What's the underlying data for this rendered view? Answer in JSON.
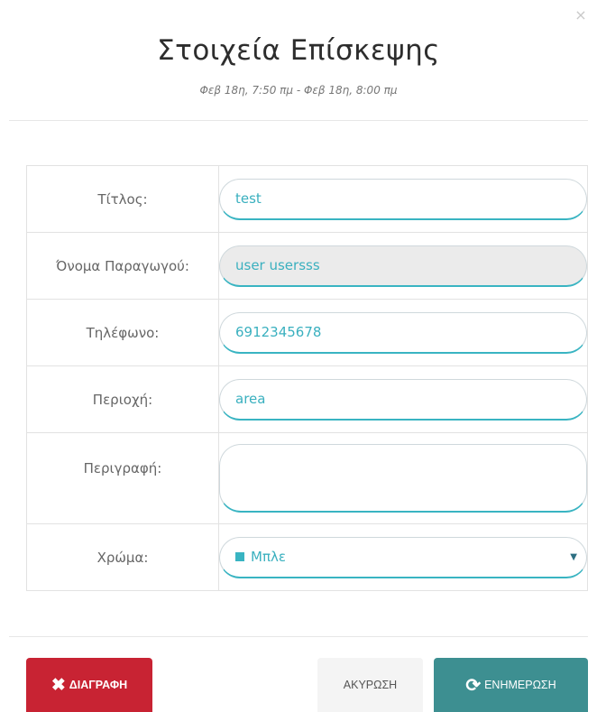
{
  "modal": {
    "close": "×",
    "title": "Στοιχεία Επίσκεψης",
    "subtitle": "Φεβ 18η, 7:50 πμ - Φεβ 18η, 8:00 πμ"
  },
  "form": {
    "title_label": "Τίτλος:",
    "title_value": "test",
    "producer_label": "Όνομα Παραγωγού:",
    "producer_value": "user usersss",
    "phone_label": "Τηλέφωνο:",
    "phone_value": "6912345678",
    "region_label": "Περιοχή:",
    "region_value": "area",
    "description_label": "Περιγραφή:",
    "description_value": "",
    "color_label": "Χρώμα:",
    "color_value": "Μπλε",
    "color_swatch": "#39b4c2"
  },
  "buttons": {
    "delete_icon": "✖",
    "delete_label": "ΔΙΑΓΡΑΦΗ",
    "cancel_label": "ΑΚΥΡΩΣΗ",
    "update_icon": "⟳",
    "update_label": "ΕΝΗΜΕΡΩΣΗ"
  },
  "colors": {
    "accent": "#39b4c2",
    "danger": "#c82333",
    "primary": "#3d8f91"
  }
}
